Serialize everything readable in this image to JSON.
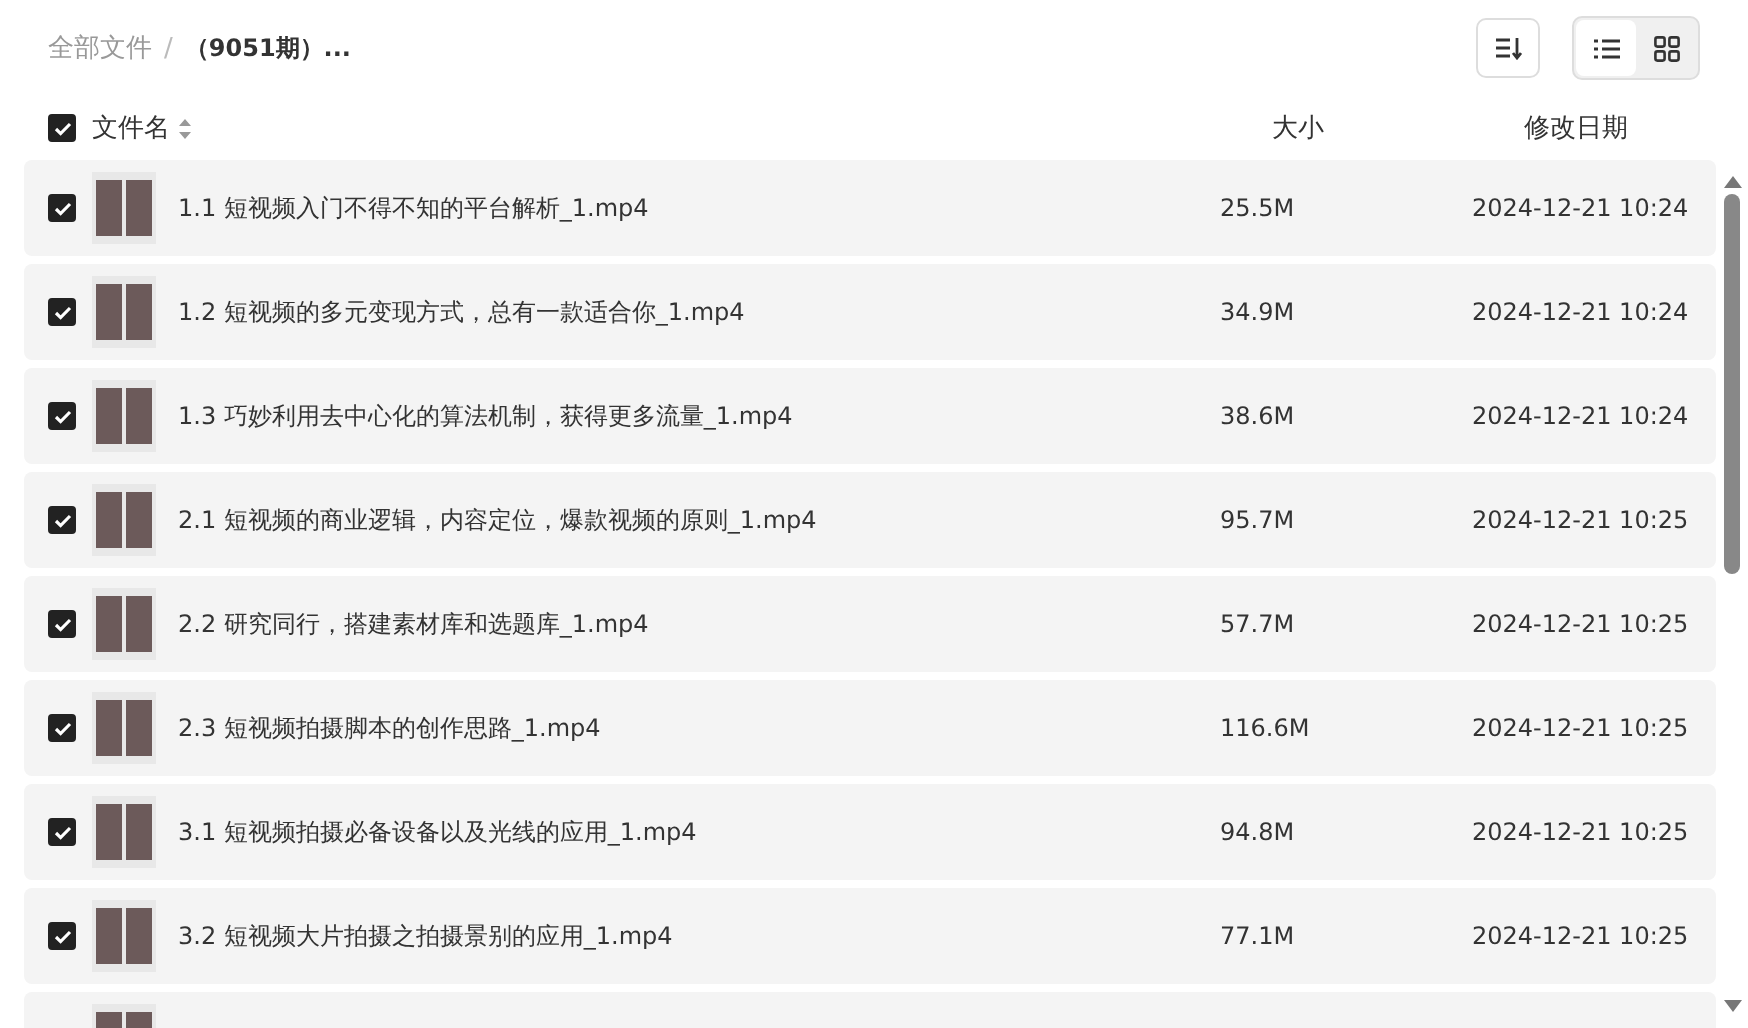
{
  "breadcrumb": {
    "root": "全部文件",
    "separator": "/",
    "current": "（9051期）..."
  },
  "view_modes": [
    {
      "kind": "list",
      "selected": true
    },
    {
      "kind": "grid",
      "selected": false
    }
  ],
  "header": {
    "select_all_checked": true,
    "name": "文件名",
    "size": "大小",
    "date": "修改日期"
  },
  "rows": [
    {
      "checked": true,
      "name": "1.1 短视频入门不得不知的平台解析_1.mp4",
      "size": "25.5M",
      "date": "2024-12-21 10:24"
    },
    {
      "checked": true,
      "name": "1.2 短视频的多元变现方式，总有一款适合你_1.mp4",
      "size": "34.9M",
      "date": "2024-12-21 10:24"
    },
    {
      "checked": true,
      "name": "1.3 巧妙利用去中心化的算法机制，获得更多流量_1.mp4",
      "size": "38.6M",
      "date": "2024-12-21 10:24"
    },
    {
      "checked": true,
      "name": "2.1 短视频的商业逻辑，内容定位，爆款视频的原则_1.mp4",
      "size": "95.7M",
      "date": "2024-12-21 10:25"
    },
    {
      "checked": true,
      "name": "2.2 研究同行，搭建素材库和选题库_1.mp4",
      "size": "57.7M",
      "date": "2024-12-21 10:25"
    },
    {
      "checked": true,
      "name": "2.3 短视频拍摄脚本的创作思路_1.mp4",
      "size": "116.6M",
      "date": "2024-12-21 10:25"
    },
    {
      "checked": true,
      "name": "3.1 短视频拍摄必备设备以及光线的应用_1.mp4",
      "size": "94.8M",
      "date": "2024-12-21 10:25"
    },
    {
      "checked": true,
      "name": "3.2 短视频大片拍摄之拍摄景别的应用_1.mp4",
      "size": "77.1M",
      "date": "2024-12-21 10:25"
    }
  ]
}
